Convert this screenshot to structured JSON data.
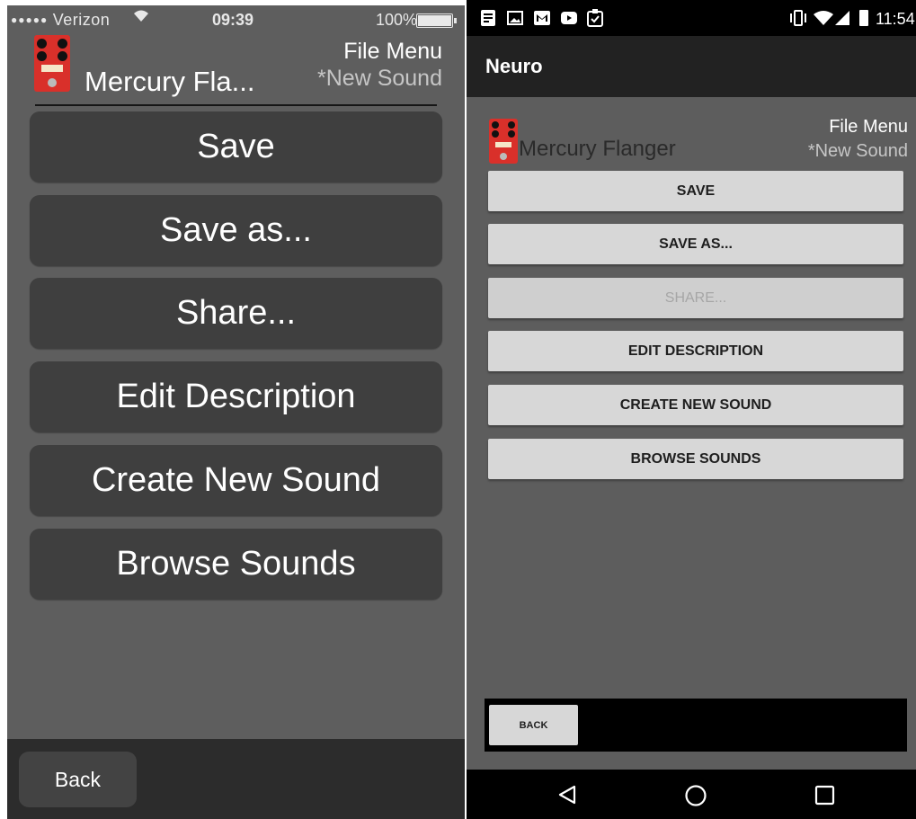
{
  "ios": {
    "status_bar": {
      "signal_dots": "●●●●●",
      "carrier": "Verizon",
      "wifi_icon": "wifi-icon",
      "time": "09:39",
      "battery_percent": "100%",
      "battery_level": 1.0
    },
    "header": {
      "pedal_icon": "pedal-icon",
      "title": "Mercury Fla...",
      "menu_label": "File Menu",
      "subtitle": "*New Sound"
    },
    "buttons": [
      {
        "label": "Save"
      },
      {
        "label": "Save as..."
      },
      {
        "label": "Share..."
      },
      {
        "label": "Edit Description"
      },
      {
        "label": "Create New Sound"
      },
      {
        "label": "Browse Sounds"
      }
    ],
    "back_label": "Back",
    "colors": {
      "background": "#5e5e5e",
      "button": "#3f3f3f",
      "bottom_bar": "#2c2c2c"
    }
  },
  "android": {
    "status_bar": {
      "notification_icons": [
        "notes-icon",
        "image-icon",
        "gmail-icon",
        "youtube-icon",
        "clipboard-check-icon"
      ],
      "system_icons": [
        "vibrate-icon",
        "wifi-icon",
        "cell-signal-icon",
        "battery-icon"
      ],
      "time": "11:54"
    },
    "app_bar": {
      "title": "Neuro"
    },
    "header": {
      "pedal_icon": "pedal-icon",
      "title": "Mercury Flanger",
      "menu_label": "File Menu",
      "subtitle": "*New Sound"
    },
    "buttons": [
      {
        "label": "SAVE",
        "enabled": true
      },
      {
        "label": "SAVE AS...",
        "enabled": true
      },
      {
        "label": "SHARE...",
        "enabled": false
      },
      {
        "label": "EDIT DESCRIPTION",
        "enabled": true
      },
      {
        "label": "CREATE NEW SOUND",
        "enabled": true
      },
      {
        "label": "BROWSE SOUNDS",
        "enabled": true
      }
    ],
    "back_label": "BACK",
    "nav_bar": [
      "back-triangle-icon",
      "home-circle-icon",
      "recents-square-icon"
    ],
    "colors": {
      "app_bar": "#222222",
      "background": "#5d5d5d",
      "button": "#d7d7d7"
    }
  }
}
